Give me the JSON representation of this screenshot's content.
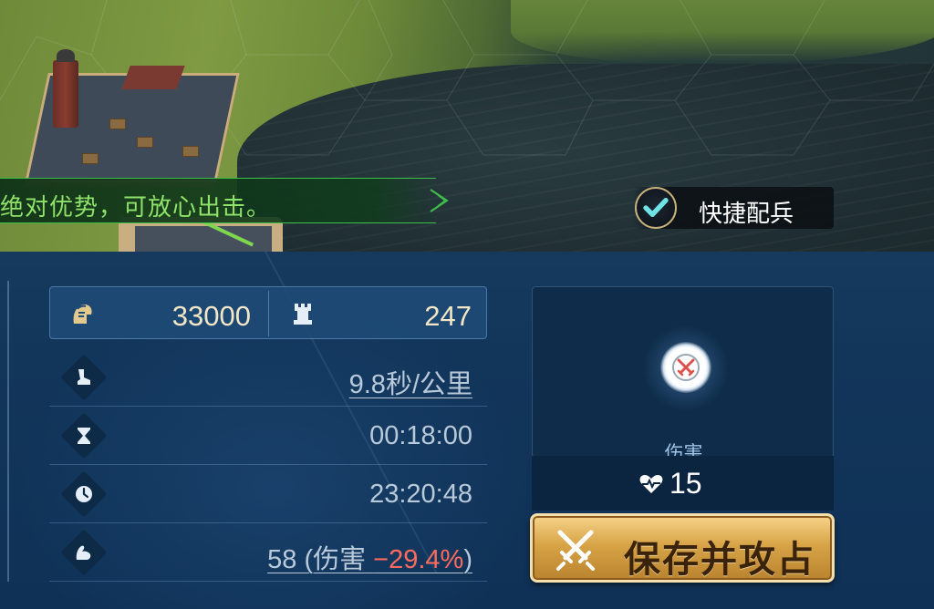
{
  "battle_advice": {
    "text": "绝对优势，可放心出击。",
    "icon": "banner-arrow-icon"
  },
  "quick_assign": {
    "checked": true,
    "label": "快捷配兵",
    "icon": "checkmark-icon"
  },
  "stats": {
    "troops": {
      "icon": "helmet-icon",
      "value": "33000"
    },
    "siege": {
      "icon": "castle-tower-icon",
      "value": "247"
    },
    "rows": [
      {
        "icon": "boot-speed-icon",
        "value": "9.8秒/公里"
      },
      {
        "icon": "hourglass-icon",
        "value": "00:18:00"
      },
      {
        "icon": "clock-icon",
        "value": "23:20:48"
      },
      {
        "icon": "stamina-arm-icon",
        "value_prefix": "58 (伤害 ",
        "value_modifier": "−29.4%",
        "value_suffix": ")"
      }
    ]
  },
  "target_card": {
    "icon": "crossed-swords-emblem-icon",
    "label": "伤害",
    "hp_icon": "heart-pulse-icon",
    "hp_value": "15"
  },
  "attack_button": {
    "icon": "crossed-swords-icon",
    "label": "保存并攻占"
  },
  "colors": {
    "advice_text": "#8fe36a",
    "panel_bg": "#12355a",
    "button_gold": "#d8a447",
    "negative_modifier": "#ff6b5e"
  }
}
